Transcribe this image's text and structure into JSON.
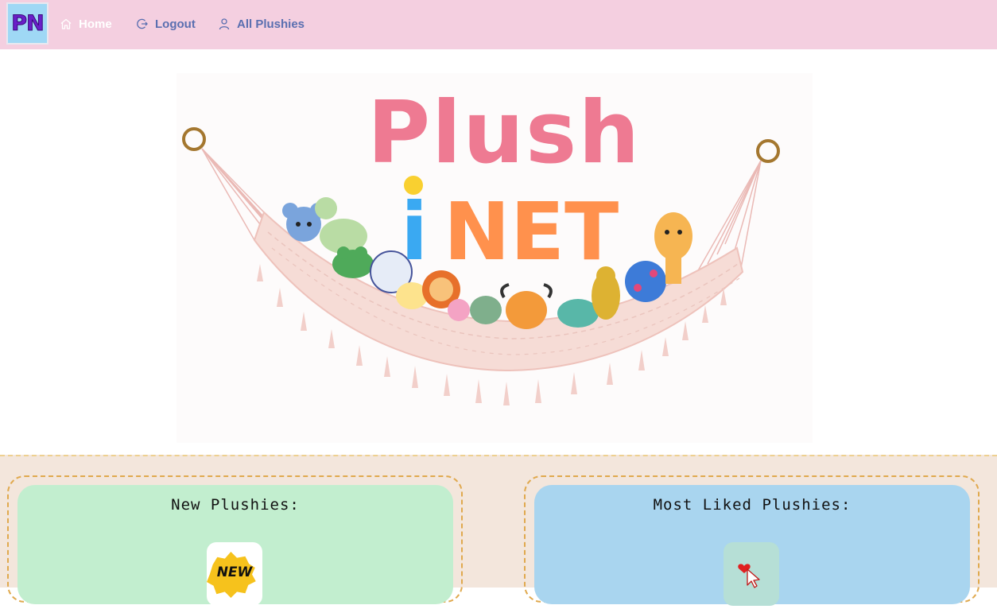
{
  "brand": {
    "logo_text": "PN"
  },
  "nav": {
    "items": [
      {
        "label": "Home",
        "icon": "home-icon"
      },
      {
        "label": "Logout",
        "icon": "logout-icon"
      },
      {
        "label": "All Plushies",
        "icon": "user-icon"
      }
    ]
  },
  "hero": {
    "title_line1": "Plush",
    "title_line2_i": "i",
    "title_line2_net": "NET"
  },
  "panels": {
    "new": {
      "title": "New Plushies:",
      "badge_text": "NEW"
    },
    "liked": {
      "title": "Most Liked Plushies:"
    }
  },
  "colors": {
    "navbar": "#f4cfe0",
    "brand_bg": "#9fd8f5",
    "brand_text": "#6a1fc9",
    "nav_text": "#5a6fb0",
    "title_pink": "#ee7a92",
    "title_blue": "#3aa9f2",
    "title_orange": "#ff914d",
    "section_bg": "#f3e6dc",
    "new_panel": "#c2eecf",
    "liked_panel": "#a9d5ef",
    "dash_border": "#e0a94e"
  }
}
